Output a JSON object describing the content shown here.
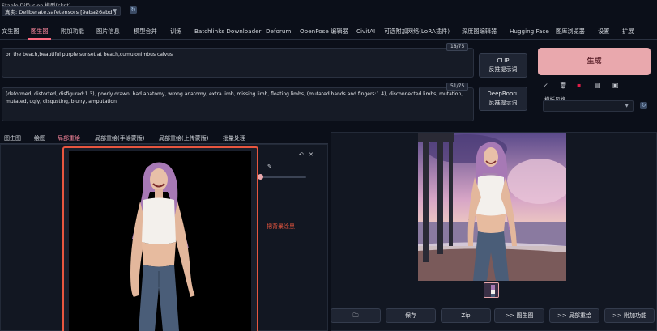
{
  "header": {
    "model_label": "Stable Diffusion 模型(ckpt)",
    "model_value": "真实: Deliberate.safetensors [9aba26abdf]",
    "refresh_icon": "refresh-icon"
  },
  "main_tabs": [
    {
      "label": "文生图",
      "active": false
    },
    {
      "label": "图生图",
      "active": true
    },
    {
      "label": "附加功能",
      "active": false
    },
    {
      "label": "图片信息",
      "active": false
    },
    {
      "label": "模型合并",
      "active": false
    },
    {
      "label": "训练",
      "active": false
    },
    {
      "label": "Batchlinks Downloader",
      "active": false
    },
    {
      "label": "Deforum",
      "active": false
    },
    {
      "label": "OpenPose 编辑器",
      "active": false
    },
    {
      "label": "CivitAI",
      "active": false
    },
    {
      "label": "可选附加网络(LoRA插件)",
      "active": false
    },
    {
      "label": "深度图编辑器",
      "active": false
    },
    {
      "label": "Hugging Face",
      "active": false
    },
    {
      "label": "图库浏览器",
      "active": false
    },
    {
      "label": "设置",
      "active": false
    },
    {
      "label": "扩展",
      "active": false
    }
  ],
  "prompt": {
    "positive": "on the beach,beautiful purple sunset at beach,cumulonimbus calvus",
    "positive_counter": "18/75",
    "negative": "(deformed, distorted, disfigured:1.3), poorly drawn, bad anatomy, wrong anatomy, extra limb, missing limb, floating limbs, (mutated hands and fingers:1.4), disconnected limbs, mutation, mutated, ugly, disgusting, blurry, amputation",
    "negative_counter": "51/75"
  },
  "side_buttons": {
    "clip_line1": "CLIP",
    "clip_line2": "反推提示词",
    "deepbooru_line1": "DeepBooru",
    "deepbooru_line2": "反推提示词",
    "generate": "生成"
  },
  "style": {
    "label": "模板风格",
    "tool_icons": [
      "arrow-icon",
      "trash-icon",
      "red-square-icon",
      "clipboard-icon",
      "save-icon"
    ]
  },
  "sub_tabs": [
    {
      "label": "图生图",
      "active": false
    },
    {
      "label": "绘图",
      "active": false
    },
    {
      "label": "局部重绘",
      "active": true
    },
    {
      "label": "局部重绘(手涂蒙版)",
      "active": false
    },
    {
      "label": "局部重绘(上传蒙版)",
      "active": false
    },
    {
      "label": "批量处理",
      "active": false
    }
  ],
  "canvas": {
    "annotation": "把背景涂黑",
    "undo_icon": "undo-icon",
    "close_icon": "close-icon",
    "brush_icon": "brush-icon"
  },
  "output_buttons": [
    {
      "label": "",
      "icon": "folder-icon"
    },
    {
      "label": "保存"
    },
    {
      "label": "Zip"
    },
    {
      "label": ">> 图生图"
    },
    {
      "label": ">> 局部重绘"
    },
    {
      "label": ">> 附加功能"
    }
  ],
  "colors": {
    "accent": "#ff6b82",
    "generate_bg": "#e9a8ad",
    "annotation": "#e8563f",
    "background": "#0b0f19"
  }
}
